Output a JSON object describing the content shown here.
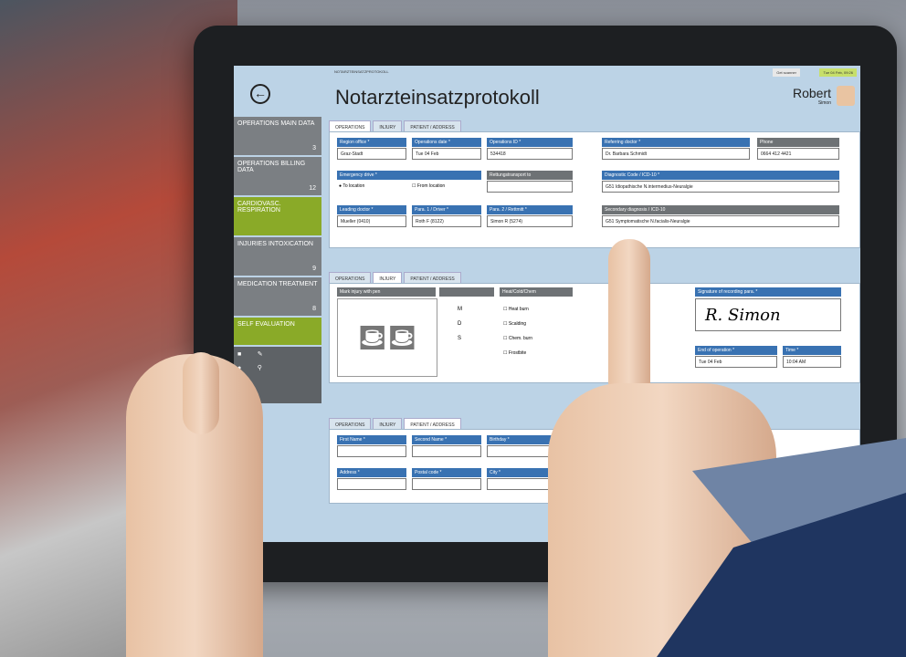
{
  "header": {
    "info": "NOTARZTEINSATZPROTOKOLL",
    "scan": "Get scanner",
    "time": "Tue 04 Feb, 09:26",
    "title": "Notarzteinsatzprotokoll",
    "user": "Robert",
    "user_sub": "Simon"
  },
  "sidebar": [
    {
      "label": "OPERATIONS MAIN DATA",
      "count": "3"
    },
    {
      "label": "OPERATIONS BILLING DATA",
      "count": "12"
    },
    {
      "label": "CARDIOVASC. RESPIRATION",
      "count": ""
    },
    {
      "label": "INJURIES INTOXICATION",
      "count": "9"
    },
    {
      "label": "MEDICATION TREATMENT",
      "count": "8"
    },
    {
      "label": "SELF EVALUATION",
      "count": ""
    }
  ],
  "tabs": [
    "OPERATIONS",
    "INJURY",
    "PATIENT / ADDRESS"
  ],
  "form1": {
    "region_label": "Region office *",
    "region": "Graz-Stadt",
    "opdate_label": "Operations date *",
    "opdate": "Tue 04 Feb",
    "opid_label": "Operations ID *",
    "opid": "534418",
    "doctor_label": "Referring doctor *",
    "doctor": "Dr. Barbara Schmidt",
    "phone_label": "Phone",
    "phone": "0664 412 4421",
    "emerg_label": "Emergency drive *",
    "to": "To location",
    "from": "From location",
    "rettung_label": "Rettungstransport to",
    "diag_label": "Diagnostic Code / ICD-10 *",
    "diag": "G51 Idiopathische N.intermedius-Neuralgie",
    "leading_label": "Leading doctor *",
    "leading": "Mueller (0410)",
    "para1_label": "Para. 1 / Driver *",
    "para1": "Roth F (8122)",
    "para2_label": "Para. 2 / Rettmitt *",
    "para2": "Simon R (5274)",
    "sec_label": "Secondary diagnosis / ICD-10",
    "sec": "G51 Symptomatische N.facialis-Neuralgie"
  },
  "form2": {
    "mark_label": "Mark injury with pen",
    "col2": "",
    "burn_label": "Heat/Cold/Chem",
    "m": "M",
    "d": "D",
    "s": "S",
    "heat": "Heat burn",
    "scald": "Scalding",
    "chem": "Chem. burn",
    "frost": "Frostbite",
    "sig_label": "Signature of recording para. *",
    "sig": "R. Simon",
    "end_label": "End of operation *",
    "end": "Tue 04 Feb",
    "time_label": "Time *",
    "time": "10:04 AM"
  },
  "form3": {
    "first": "First Name *",
    "second": "Second Name *",
    "birthday": "Birthday *",
    "address": "Address *",
    "postal": "Postal code *",
    "city": "City *"
  }
}
